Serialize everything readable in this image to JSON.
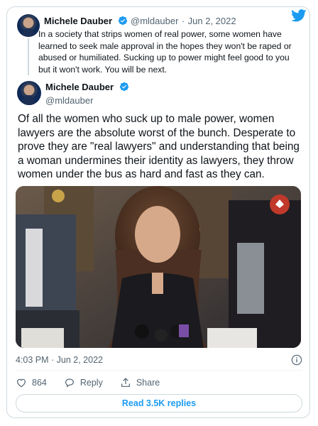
{
  "quoted": {
    "author_name": "Michele Dauber",
    "handle": "@mldauber",
    "separator": "·",
    "date": "Jun 2, 2022",
    "text": "In a society that strips women of real power, some women have learned to seek male approval in the hopes they won't be raped or abused or humiliated. Sucking up to power might feel good to you but it won't work. You will be next."
  },
  "tweet": {
    "author_name": "Michele Dauber",
    "handle": "@mldauber",
    "text": "Of all the women who suck up to male power, women lawyers are the absolute worst of the bunch. Desperate to prove they are \"real lawyers\" and understanding that being a woman undermines their identity as lawyers, they throw women under the bus as hard and fast as they can.",
    "timestamp": "4:03 PM · Jun 2, 2022",
    "likes": "864",
    "reply_label": "Reply",
    "share_label": "Share",
    "read_replies_label": "Read 3.5K replies"
  },
  "colors": {
    "accent": "#1d9bf0",
    "text": "#0f1419",
    "muted": "#536471",
    "border": "#cfd9de"
  },
  "icons": [
    "twitter-bird-icon",
    "verified-badge-icon",
    "info-icon",
    "heart-icon",
    "reply-icon",
    "share-icon"
  ]
}
